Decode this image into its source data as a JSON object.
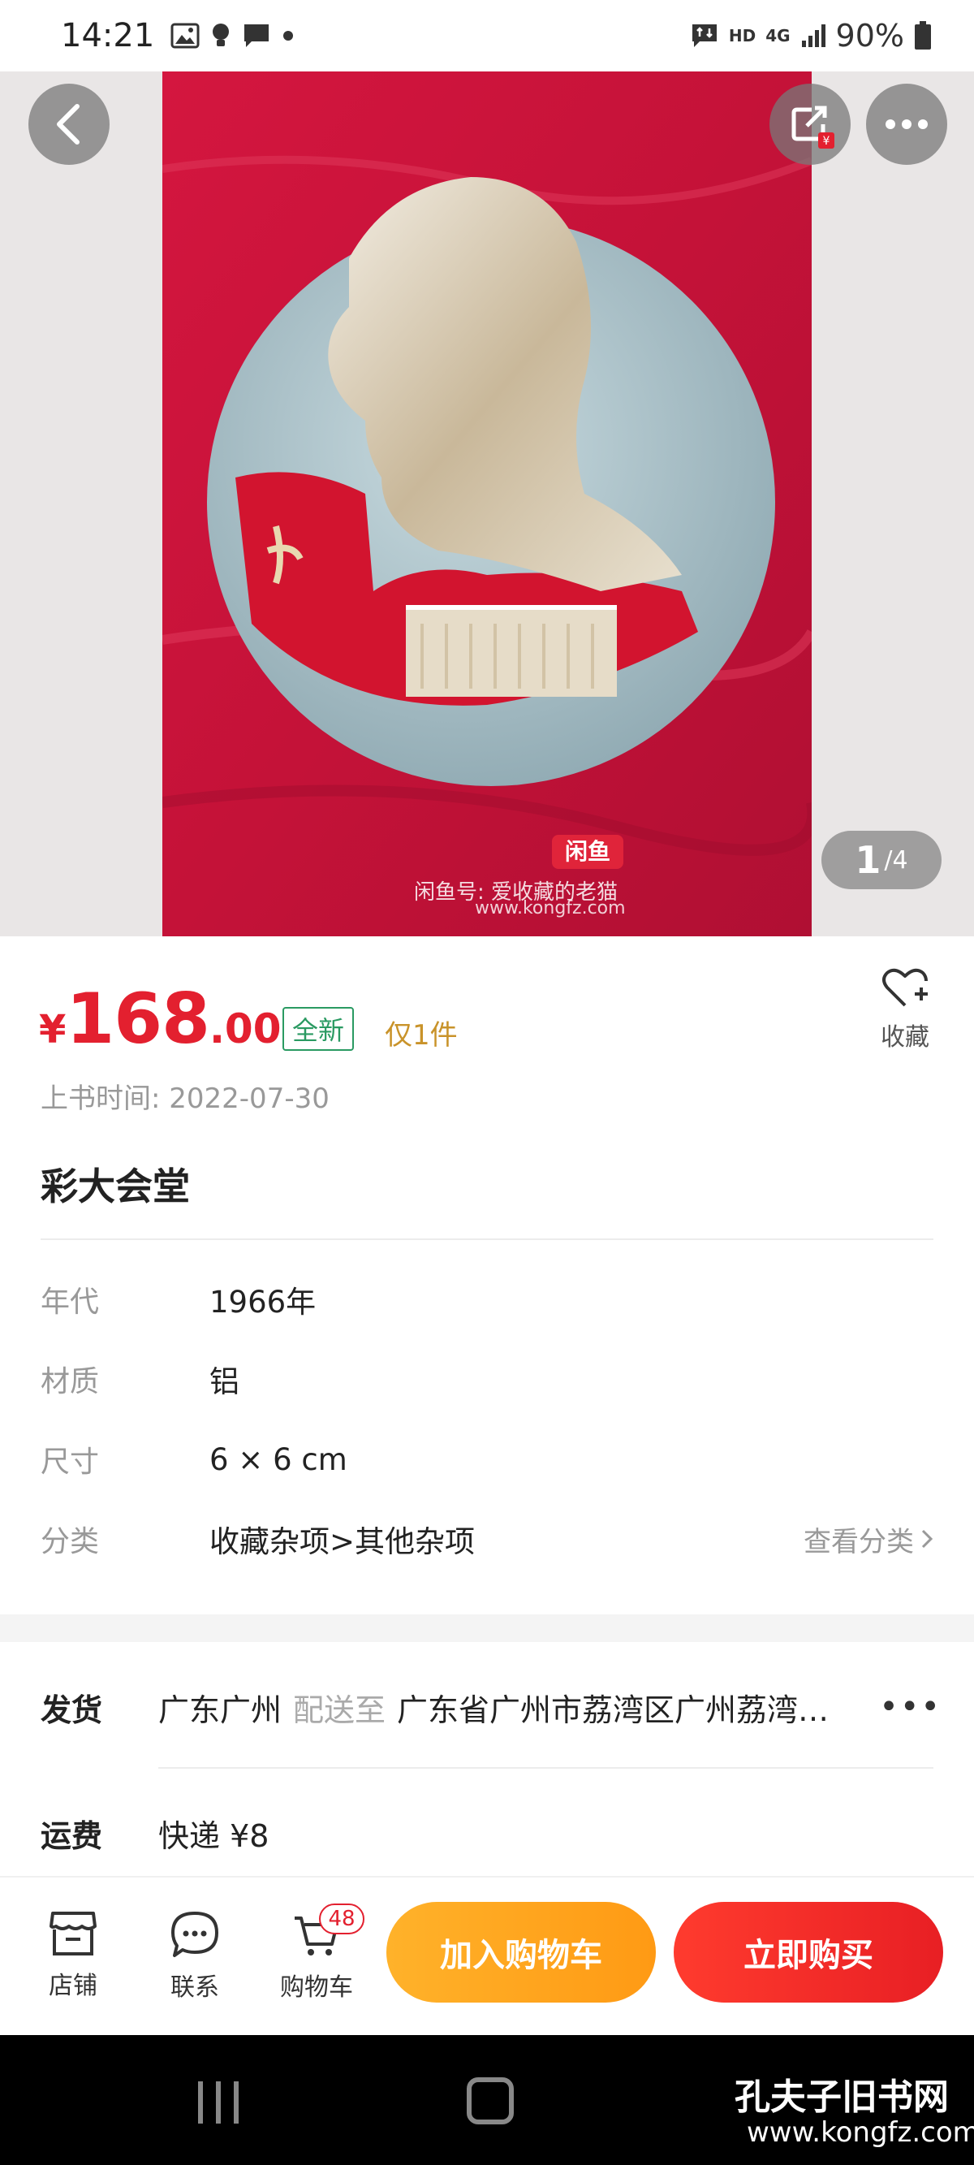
{
  "status_bar": {
    "time": "14:21",
    "network": "HD",
    "signal": "4G",
    "battery": "90%"
  },
  "gallery": {
    "current_page": "1",
    "total_pages": "/4",
    "watermark_badge": "闲鱼",
    "watermark_text": "闲鱼号: 爱收藏的老猫",
    "watermark_url": "www.kongfz.com"
  },
  "price": {
    "currency": "¥",
    "integer": "168",
    "decimal": ".00",
    "condition_tag": "全新",
    "stock_note": "仅1件",
    "color": "#e3202f"
  },
  "favorite_label": "收藏",
  "post_time": "上书时间: 2022-07-30",
  "title": "彩大会堂",
  "attributes": [
    {
      "key": "年代",
      "value": "1966年"
    },
    {
      "key": "材质",
      "value": "铝"
    },
    {
      "key": "尺寸",
      "value": "6 × 6 cm"
    },
    {
      "key": "分类",
      "value": "收藏杂项>其他杂项",
      "link": "查看分类"
    }
  ],
  "shipping": {
    "from_label": "发货",
    "from": "广东广州",
    "deliver_to_label": "配送至",
    "deliver_to": "广东省广州市荔湾区广州荔湾…",
    "fee_label": "运费",
    "fee": "快递 ¥8"
  },
  "actions": {
    "shop": "店铺",
    "contact": "联系",
    "cart": "购物车",
    "cart_count": "48",
    "add_to_cart": "加入购物车",
    "buy_now": "立即购买"
  },
  "system_watermark": {
    "line1": "孔夫子旧书网",
    "line2": "www.kongfz.com"
  }
}
